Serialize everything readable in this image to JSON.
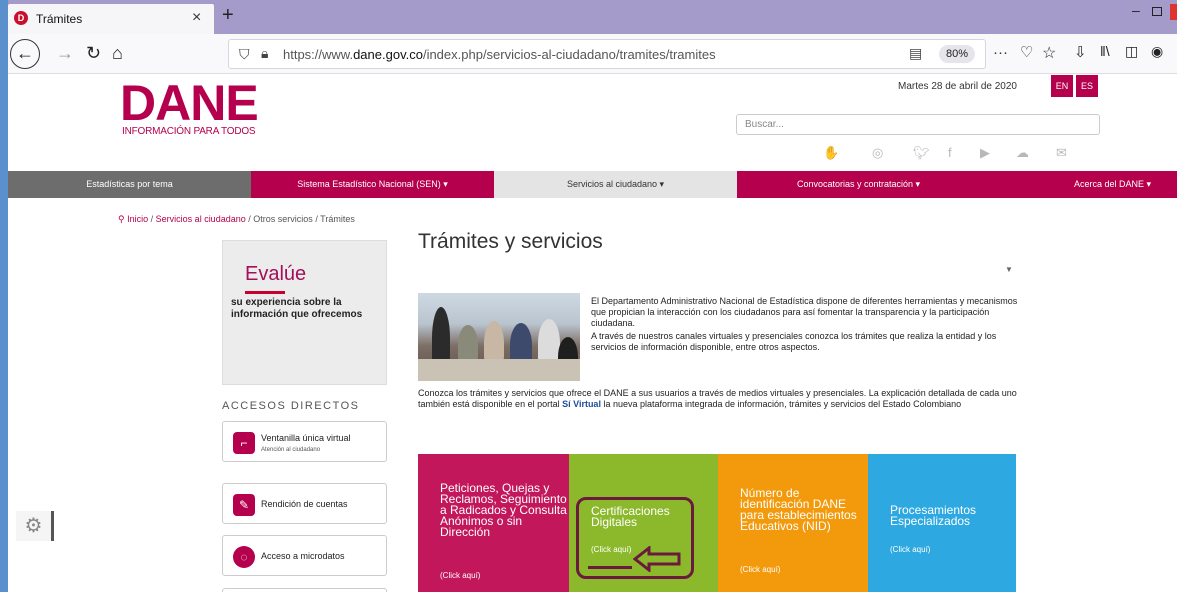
{
  "browser": {
    "tab_title": "Trámites",
    "tab_close": "×",
    "new_tab": "+",
    "url_prefix": "https://www.",
    "url_domain": "dane.gov.co",
    "url_path": "/index.php/servicios-al-ciudadano/tramites/tramites",
    "zoom": "80%",
    "url_more": "···"
  },
  "header": {
    "logo_text": "DANE",
    "logo_tagline": "INFORMACIÓN PARA TODOS",
    "date": "Martes 28 de abril de 2020",
    "lang_en": "EN",
    "lang_es": "ES",
    "search_placeholder": "Buscar..."
  },
  "menu": [
    {
      "label": "Estadísticas por tema"
    },
    {
      "label": "Sistema Estadístico Nacional (SEN) ▾"
    },
    {
      "label": "Servicios al ciudadano ▾"
    },
    {
      "label": "Convocatorias y contratación ▾"
    },
    {
      "label": "Acerca del DANE ▾"
    }
  ],
  "breadcrumb": {
    "home": "Inicio",
    "sep": "/",
    "servicios": "Servicios al ciudadano",
    "otros": "Otros servicios",
    "current": "Trámites"
  },
  "main": {
    "title": "Trámites y servicios",
    "desc_p1": "El Departamento Administrativo Nacional de Estadística dispone de diferentes herramientas y mecanismos que propician la interacción con los ciudadanos para así fomentar la transparencia y la participación ciudadana.",
    "desc_p2": "A través de nuestros canales virtuales y presenciales conozca los trámites que realiza la entidad y los servicios de información disponible, entre otros aspectos.",
    "lead_a": "Conozca los trámites y servicios que ofrece el DANE a sus usuarios a través de medios virtuales y presenciales. La explicación detallada de cada uno también está disponible en el portal ",
    "lead_link": "Sí Virtual",
    "lead_b": " la nueva plataforma integrada de información, trámites y servicios del Estado Colombiano"
  },
  "evalue": {
    "title": "Evalúe",
    "text": "su experiencia sobre la información que ofrecemos"
  },
  "accesos": {
    "heading": "ACCESOS DIRECTOS",
    "items": [
      {
        "label": "Ventanilla única virtual",
        "sub": "Atención al ciudadano"
      },
      {
        "label": "Rendición de cuentas",
        "sub": ""
      },
      {
        "label": "Acceso a microdatos",
        "sub": ""
      }
    ]
  },
  "tiles": [
    {
      "title": "Peticiones, Quejas y Reclamos, Seguimiento a Radicados y Consulta Anónimos o sin Dirección",
      "click": "(Click aquí)",
      "color": "#c2185b"
    },
    {
      "title": "Certificaciones Digitales",
      "click": "(Click aquí)",
      "color": "#8cb92b"
    },
    {
      "title": "Número de identificación DANE para establecimientos Educativos (NID)",
      "click": "(Click aquí)",
      "color": "#f39a0c"
    },
    {
      "title": "Procesamientos Especializados",
      "click": "(Click aquí)",
      "color": "#2ea8e0"
    }
  ]
}
